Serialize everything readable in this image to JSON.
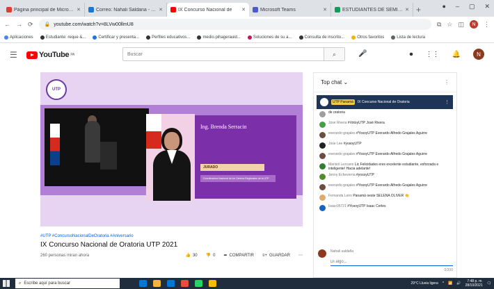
{
  "browser": {
    "tabs": [
      {
        "label": "Página principal de Microsoft",
        "color": "#e53935",
        "active": false
      },
      {
        "label": "Correo: Nahali Saldana - Out",
        "color": "#1976d2",
        "active": false
      },
      {
        "label": "IX Concurso Nacional de",
        "color": "#ff0000",
        "active": true
      },
      {
        "label": "Microsoft Teams",
        "color": "#5059c9",
        "active": false
      },
      {
        "label": "ESTUDIANTES DE SEMINARIO",
        "color": "#0f9d58",
        "active": false
      }
    ],
    "new_tab": "+",
    "url": "youtube.com/watch?v=8LVw00llmU8",
    "profile_initial": "N",
    "bookmarks": [
      {
        "label": "Aplicaciones",
        "color": "#4285f4"
      },
      {
        "label": "Estudiante: reque &...",
        "color": "#333"
      },
      {
        "label": "Certificar y presenta...",
        "color": "#1a73e8"
      },
      {
        "label": "Perfiles educativos...",
        "color": "#333"
      },
      {
        "label": "medio.pihagerauid...",
        "color": "#333"
      },
      {
        "label": "Soluciones de su a...",
        "color": "#c2185b"
      },
      {
        "label": "Consulta de inscrito...",
        "color": "#333"
      },
      {
        "label": "Otros favoritos",
        "color": "#f4b400"
      },
      {
        "label": "Lista de lectura",
        "color": "#5f6368"
      }
    ]
  },
  "youtube": {
    "logo_text": "YouTube",
    "logo_sup": "PA",
    "search_placeholder": "Buscar",
    "user_initial": "N"
  },
  "video": {
    "emblem_text": "UTP",
    "speaker_name": "Ing. Brenda Serracin",
    "jurado_label": "JURADO",
    "role_text": "Coordinadora Nacional de los Centros Regionales de la UTP",
    "hashtags": "#UTP #ConcursoNacionalDeOratoria #Aniversario",
    "title": "IX Concurso Nacional de Oratoria UTP 2021",
    "views": "260 personas miran ahora",
    "likes": "30",
    "dislikes": "0",
    "share": "COMPARTIR",
    "save": "GUARDAR"
  },
  "chat": {
    "header": "Top chat",
    "pinned_badge": "UTP Panamá",
    "pinned_text": "IX Concurso Nacional de Oratoria",
    "messages": [
      {
        "author": "",
        "text": "de oratoria",
        "color": "#9e9e9e"
      },
      {
        "author": "Jose Rivera",
        "text": "#VotoyUTP José Rivera",
        "color": "#43a047"
      },
      {
        "author": "everardo grajales",
        "text": "#YosoyUTP Everardo Alfredo Grajales Aguirre",
        "color": "#6d4c41"
      },
      {
        "author": "Jose Lee",
        "text": "#yosoyUTP",
        "color": "#212121"
      },
      {
        "author": "everardo grajales",
        "text": "#YosoyUTP Everardo Alfredo Grajales Aguirre",
        "color": "#6d4c41"
      },
      {
        "author": "Marisol Lezcano",
        "text": "Lic Felicidades eres excelente estudiante, esforzada e inteligente! Hacia adelante!",
        "color": "#2e7d32"
      },
      {
        "author": "Jenny Echeverria",
        "text": "#yosoyUTP",
        "color": "#558b2f"
      },
      {
        "author": "everardo grajales",
        "text": "#YosoyUTP Everardo Alfredo Grajales Aguirre",
        "color": "#6d4c41"
      },
      {
        "author": "Fernanda Leiro",
        "text": "Panamá oeste SELENA OLIVER 👏",
        "color": "#e0a96d"
      },
      {
        "author": "Isaac05721",
        "text": "#YosoyUTP Isaac Cerles",
        "color": "#1565c0"
      }
    ],
    "input_name": "Nahali saldaña",
    "input_placeholder": "Di algo...",
    "counter": "0/200"
  },
  "taskbar": {
    "search_placeholder": "Escribe aquí para buscar",
    "weather": "29°C Lluvia ligera",
    "time": "7:48 p. m.",
    "date": "28/10/2021",
    "icons": [
      "#0078d4",
      "#f3b33d",
      "#0078d4",
      "#e74c3c",
      "#25d366",
      "#fbbc05"
    ]
  }
}
